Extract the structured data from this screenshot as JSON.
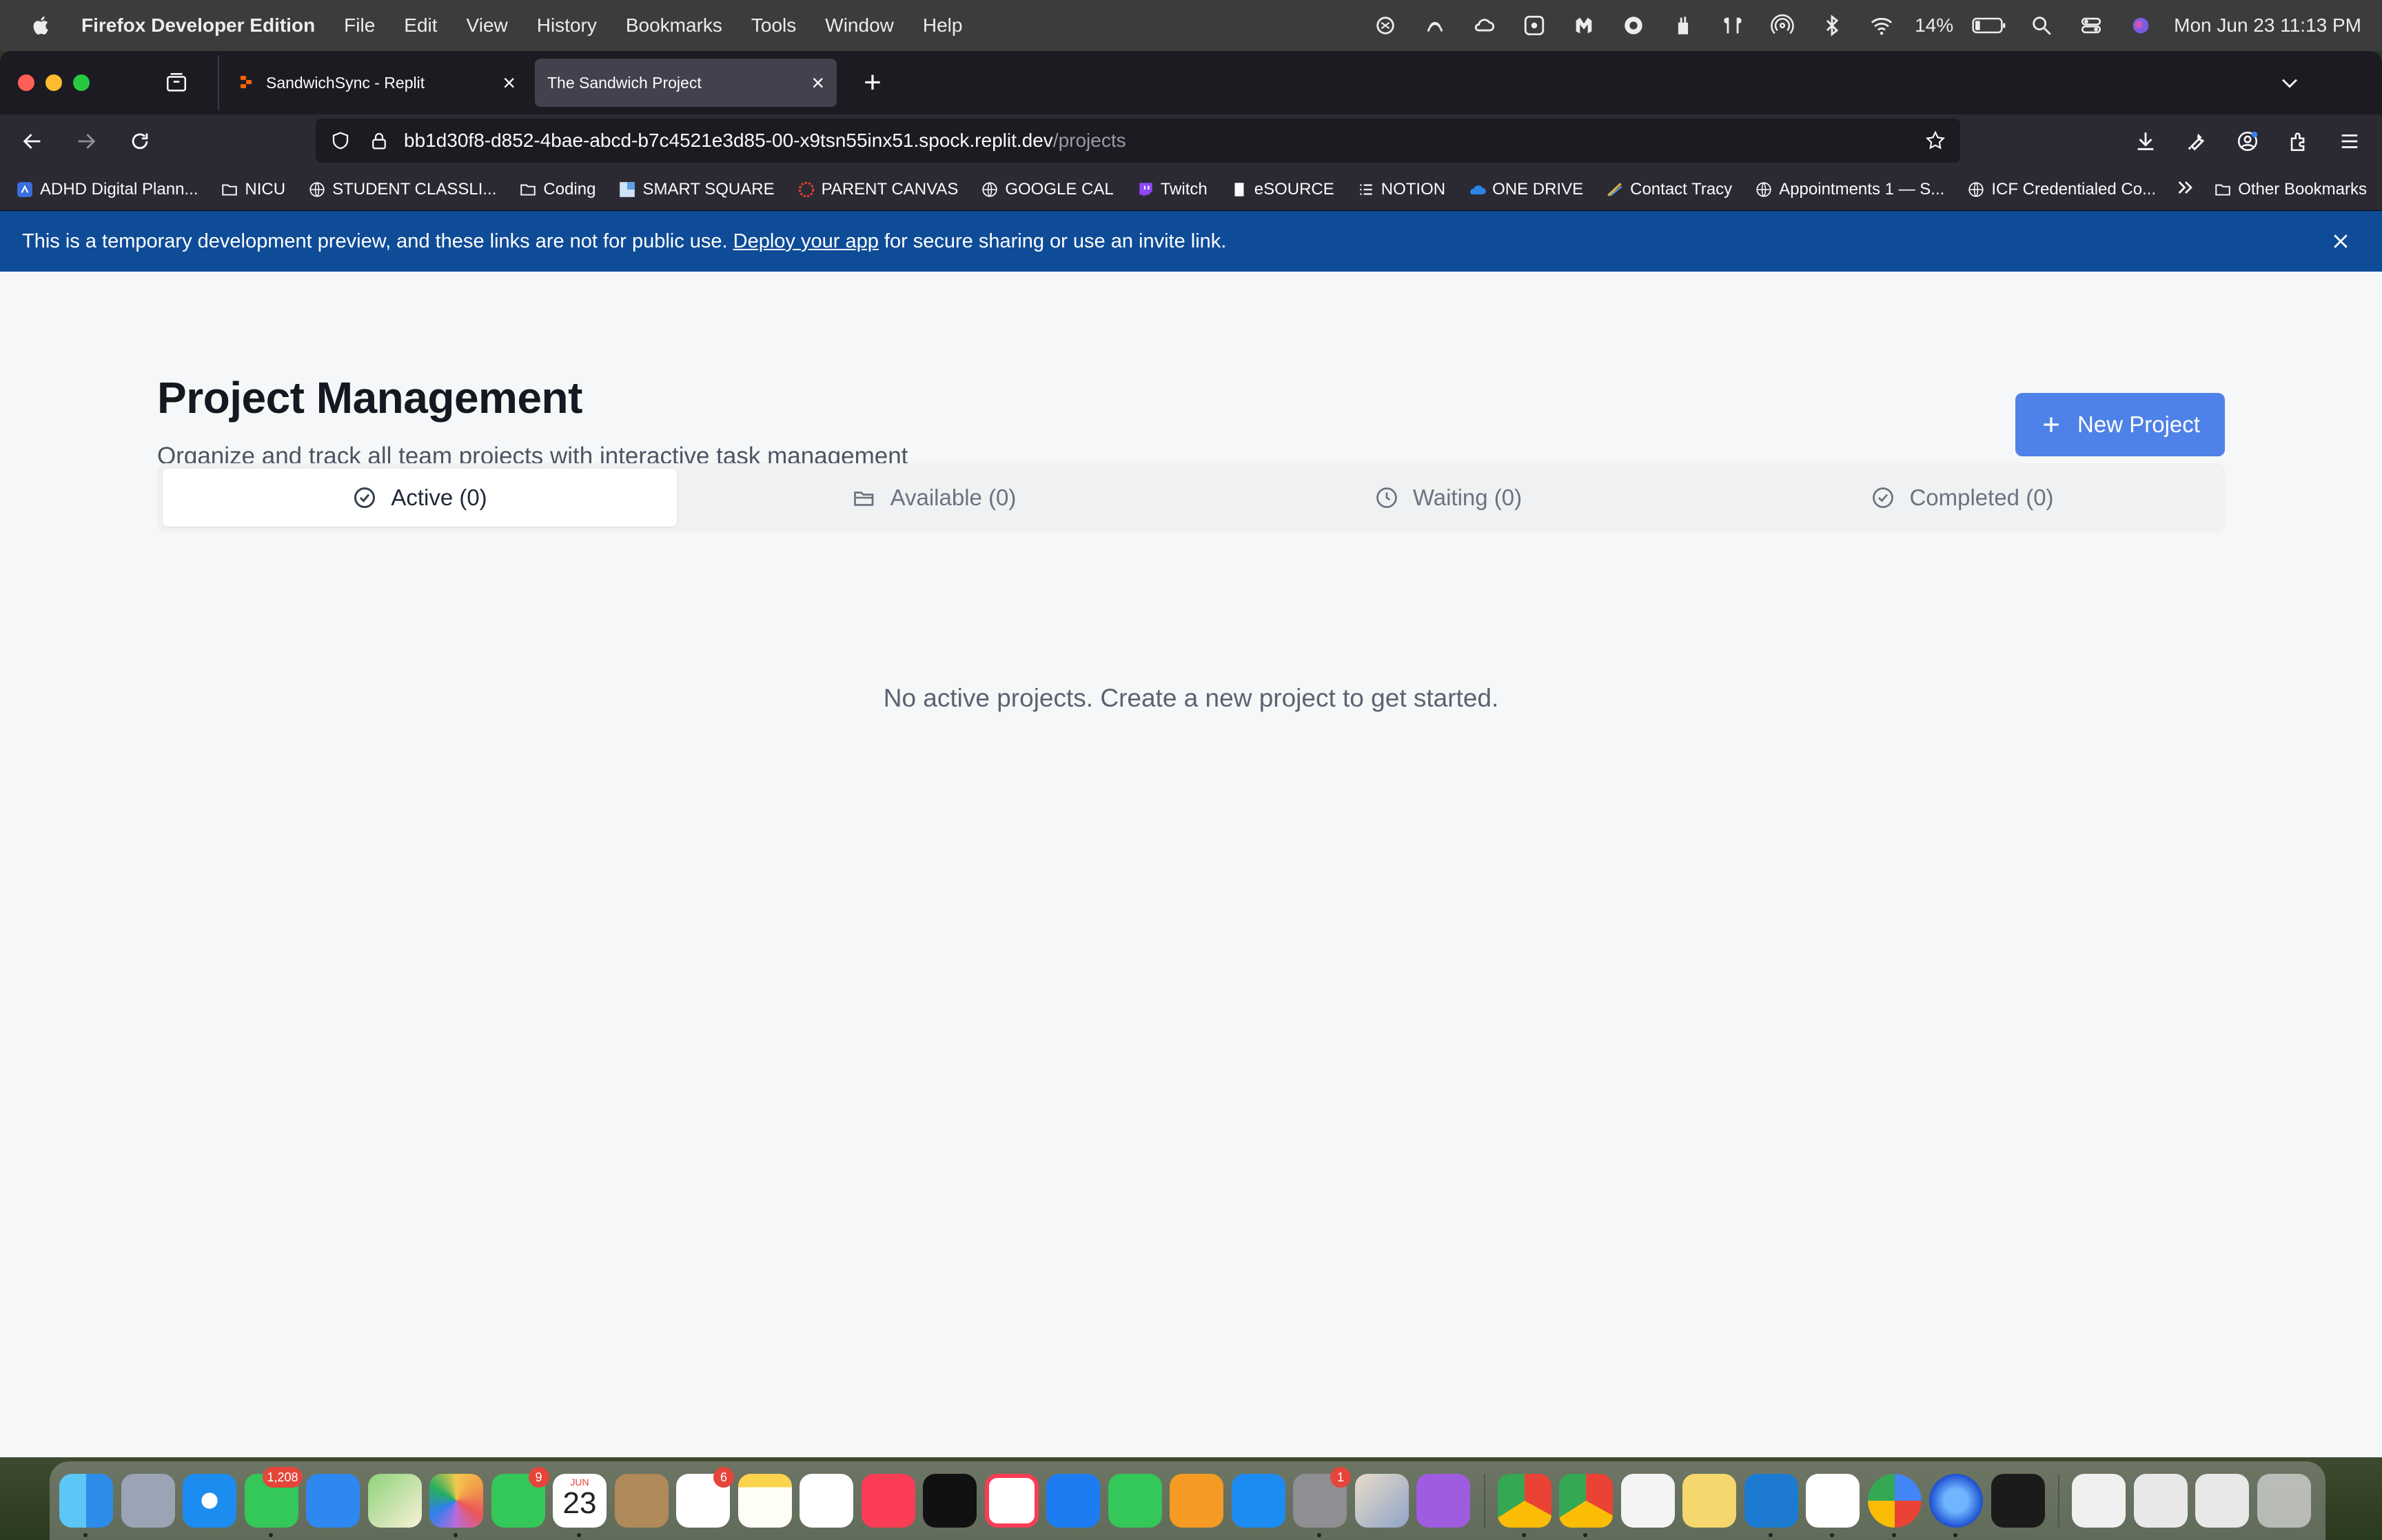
{
  "menubar": {
    "app_name": "Firefox Developer Edition",
    "items": [
      "File",
      "Edit",
      "View",
      "History",
      "Bookmarks",
      "Tools",
      "Window",
      "Help"
    ],
    "battery": "14%",
    "clock": "Mon Jun 23  11:13 PM"
  },
  "browser": {
    "tabs": [
      {
        "title": "SandwichSync - Replit",
        "active": false
      },
      {
        "title": "The Sandwich Project",
        "active": true
      }
    ],
    "url_host": "bb1d30f8-d852-4bae-abcd-b7c4521e3d85-00-x9tsn55inx51.spock.replit.dev",
    "url_path": "/projects",
    "bookmarks": [
      "ADHD Digital Plann...",
      "NICU",
      "STUDENT CLASSLI...",
      "Coding",
      "SMART SQUARE",
      "PARENT CANVAS",
      "GOOGLE CAL",
      "Twitch",
      "eSOURCE",
      "NOTION",
      "ONE DRIVE",
      "Contact Tracy",
      "Appointments 1 — S...",
      "ICF Credentialed Co..."
    ],
    "other_bookmarks": "Other Bookmarks"
  },
  "banner": {
    "text_before": "This is a temporary development preview, and these links are not for public use. ",
    "link": "Deploy your app",
    "text_after": " for secure sharing or use an invite link."
  },
  "page": {
    "title": "Project Management",
    "subtitle": "Organize and track all team projects with interactive task management",
    "new_button": "New Project",
    "tabs": [
      {
        "label": "Active (0)",
        "icon": "check-circle-icon",
        "selected": true
      },
      {
        "label": "Available (0)",
        "icon": "folder-open-icon",
        "selected": false
      },
      {
        "label": "Waiting (0)",
        "icon": "clock-icon",
        "selected": false
      },
      {
        "label": "Completed (0)",
        "icon": "check-circle-icon",
        "selected": false
      }
    ],
    "empty_message": "No active projects. Create a new project to get started."
  },
  "dock": {
    "badges": {
      "messages": "1,208",
      "facetime": "9",
      "reminders": "6",
      "settings": "1"
    },
    "calendar_month": "JUN",
    "calendar_day": "23"
  },
  "colors": {
    "accent": "#4f82e8",
    "banner": "#0f4c97",
    "toolbar": "#2b2a33",
    "tabstrip": "#1c1b22"
  }
}
